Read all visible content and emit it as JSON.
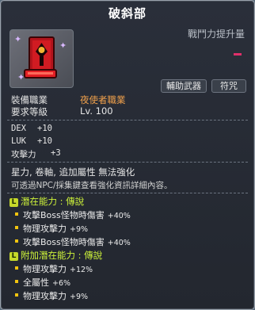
{
  "item": {
    "name": "破斜部",
    "power_label": "戰鬥力提升量",
    "tags": [
      "輔助武器",
      "符咒"
    ],
    "requirements": [
      {
        "label": "裝備職業",
        "value": "夜使者職業",
        "color": "#f0a04b"
      },
      {
        "label": "要求等級",
        "value": "Lv. 100",
        "color": "#e6e6e6"
      }
    ],
    "stats": [
      {
        "name": "DEX",
        "value": "+10"
      },
      {
        "name": "LUK",
        "value": "+10"
      },
      {
        "name": "攻擊力",
        "value": "+3"
      }
    ],
    "flags": "星力, 卷軸, 追加屬性 無法強化",
    "note": "可透過NPC/採集鍵查看強化資訊詳細內容。"
  },
  "potential": {
    "title": "潛在能力 : 傳說",
    "badge": "L",
    "lines": [
      {
        "text": "攻擊Boss怪物時傷害",
        "value": "+40%"
      },
      {
        "text": "物理攻擊力",
        "value": "+9%"
      },
      {
        "text": "攻擊Boss怪物時傷害",
        "value": "+40%"
      }
    ]
  },
  "additional_potential": {
    "title": "附加潛在能力 : 傳說",
    "badge": "L",
    "lines": [
      {
        "text": "物理攻擊力",
        "value": "+12%"
      },
      {
        "text": "全屬性",
        "value": "+6%"
      },
      {
        "text": "物理攻擊力",
        "value": "+9%"
      }
    ]
  },
  "colors": {
    "potential_title": "#cdf23a",
    "job_value": "#f0a04b",
    "bullet": "#f1c40f"
  },
  "icons": [
    "item-charm-icon",
    "sparkle-icon"
  ]
}
